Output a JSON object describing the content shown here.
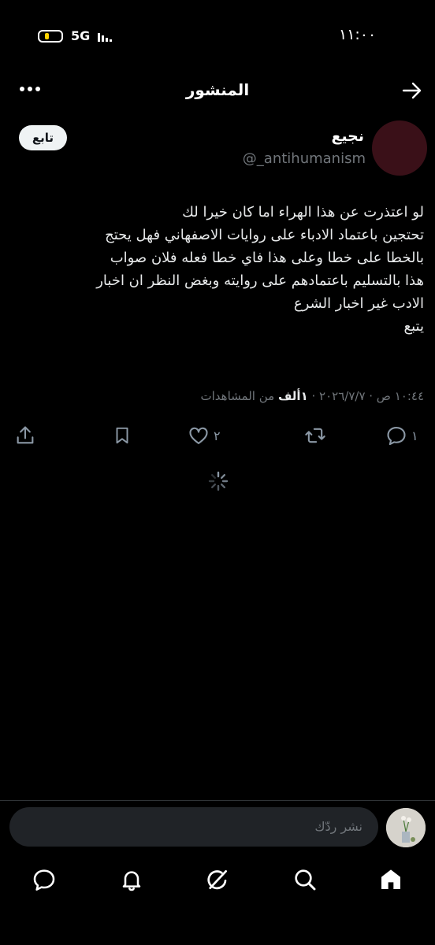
{
  "status_bar": {
    "time": "١١:٠٠",
    "network": "5G"
  },
  "header": {
    "title": "المنشور"
  },
  "post": {
    "author_name": "نجيع",
    "handle": "@_antihumanism",
    "follow_label": "تابع",
    "lines": [
      "لو اعتذرت عن هذا الهراء اما كان خيرا لك",
      "تحتجين باعتماد الادباء على روايات الاصفهاني فهل يحتج",
      "بالخطا على خطا وعلى هذا فاي  خطا فعله فلان صواب",
      "هذا بالتسليم باعتمادهم على روايته وبغض النظر ان اخبار",
      "الادب غير اخبار الشرع",
      "يتبع"
    ],
    "timestamp": "١٠:٤٤ ص · ٢٠٢٦/٧/٧ · ",
    "views_count": "١ألف",
    "views_label": " من المشاهدات"
  },
  "actions": {
    "replies": "١",
    "reposts": "",
    "likes": "٢"
  },
  "reply_bar": {
    "placeholder": "نشر ردّك"
  },
  "nav": {
    "items": [
      "home",
      "search",
      "grok",
      "notifications",
      "messages"
    ]
  }
}
